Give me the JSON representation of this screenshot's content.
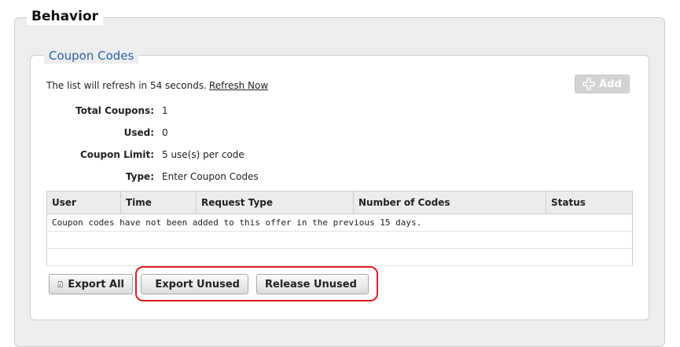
{
  "behavior": {
    "title": "Behavior"
  },
  "coupon_codes": {
    "title": "Coupon Codes",
    "refresh_text": "The list will refresh in 54 seconds.",
    "refresh_link": "Refresh Now",
    "add_label": "Add",
    "info": [
      {
        "label": "Total Coupons:",
        "value": "1"
      },
      {
        "label": "Used:",
        "value": "0"
      },
      {
        "label": "Coupon Limit:",
        "value": "5 use(s) per code"
      },
      {
        "label": "Type:",
        "value": "Enter Coupon Codes"
      }
    ],
    "table": {
      "columns": [
        "User",
        "Time",
        "Request Type",
        "Number of Codes",
        "Status"
      ],
      "empty_message": "Coupon codes have not been added to this offer in the previous 15 days."
    },
    "buttons": {
      "export_all": "Export All",
      "export_unused": "Export Unused",
      "release_unused": "Release Unused"
    }
  },
  "colors": {
    "title_blue": "#2a63a8",
    "highlight_red": "#d62020",
    "panel_bg": "#ededed"
  }
}
